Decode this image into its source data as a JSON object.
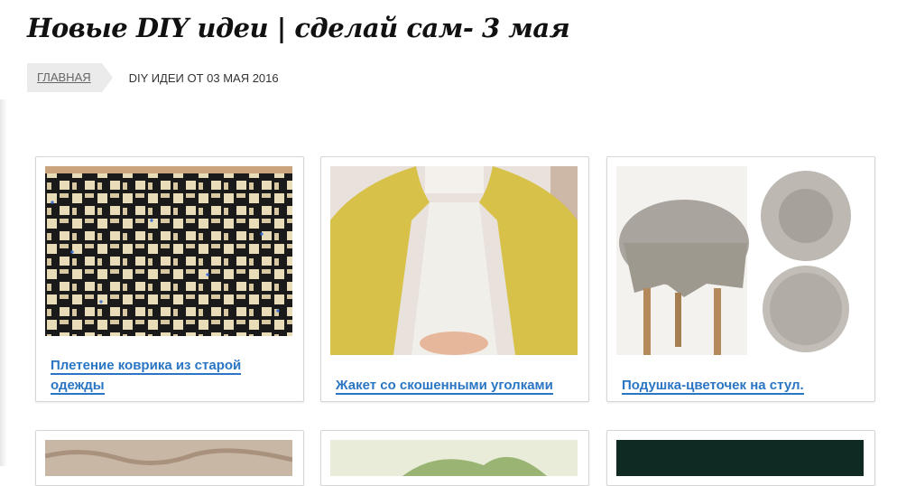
{
  "page": {
    "title": "Новые DIY идеи | сделай сам- 3 мая"
  },
  "breadcrumb": {
    "home_label": "ГЛАВНАЯ",
    "current_label": "DIY ИДЕИ ОТ 03 МАЯ 2016"
  },
  "cards": [
    {
      "title": "Плетение коврика из старой одежды"
    },
    {
      "title": "Жакет со скошенными уголками"
    },
    {
      "title": "Подушка-цветочек на стул."
    }
  ],
  "colors": {
    "link": "#2a76c4",
    "breadcrumb_bg": "#ebebeb",
    "card_border": "#d6d6d6"
  }
}
